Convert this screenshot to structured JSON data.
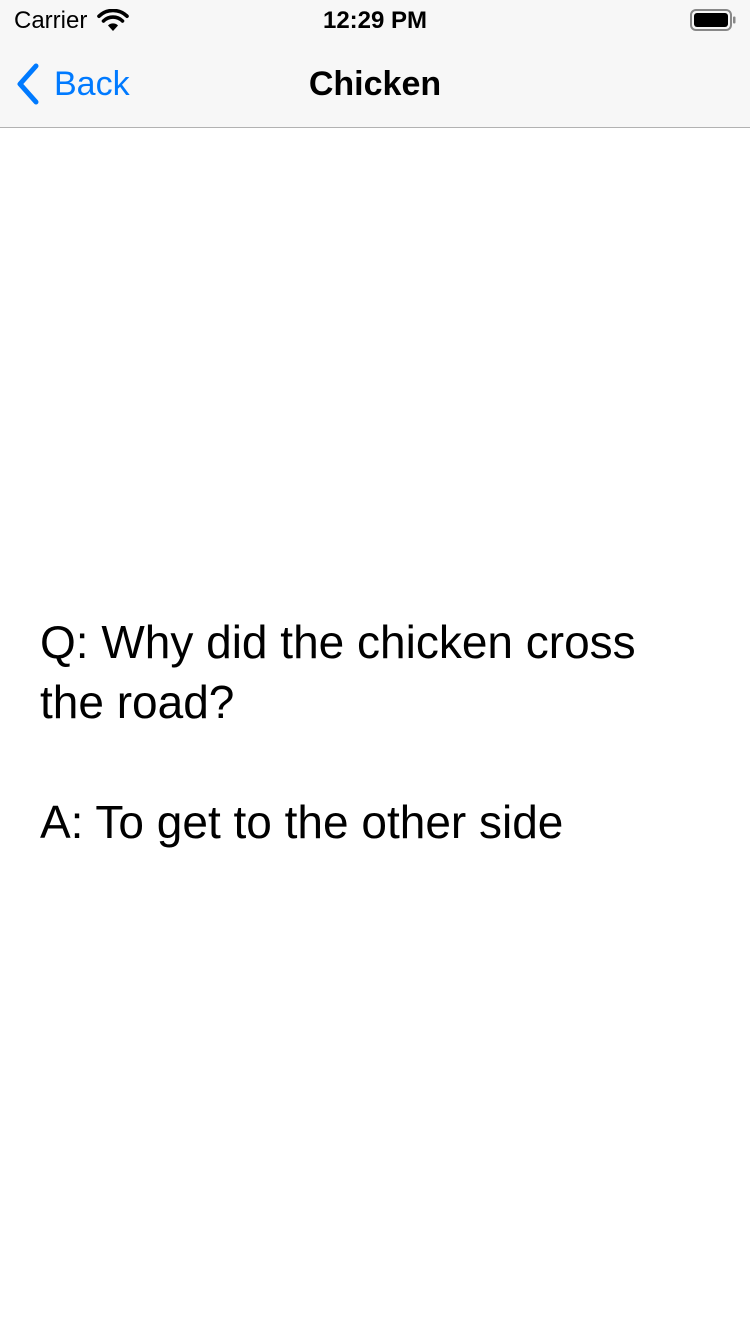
{
  "status_bar": {
    "carrier": "Carrier",
    "time": "12:29 PM",
    "wifi_icon": "wifi-icon",
    "battery_icon": "battery-icon"
  },
  "nav": {
    "back_label": "Back",
    "back_icon": "chevron-left-icon",
    "title": "Chicken",
    "accent_color": "#007aff"
  },
  "joke": {
    "question": "Q: Why did the chicken cross the road?",
    "answer": "A: To get to the other side"
  }
}
